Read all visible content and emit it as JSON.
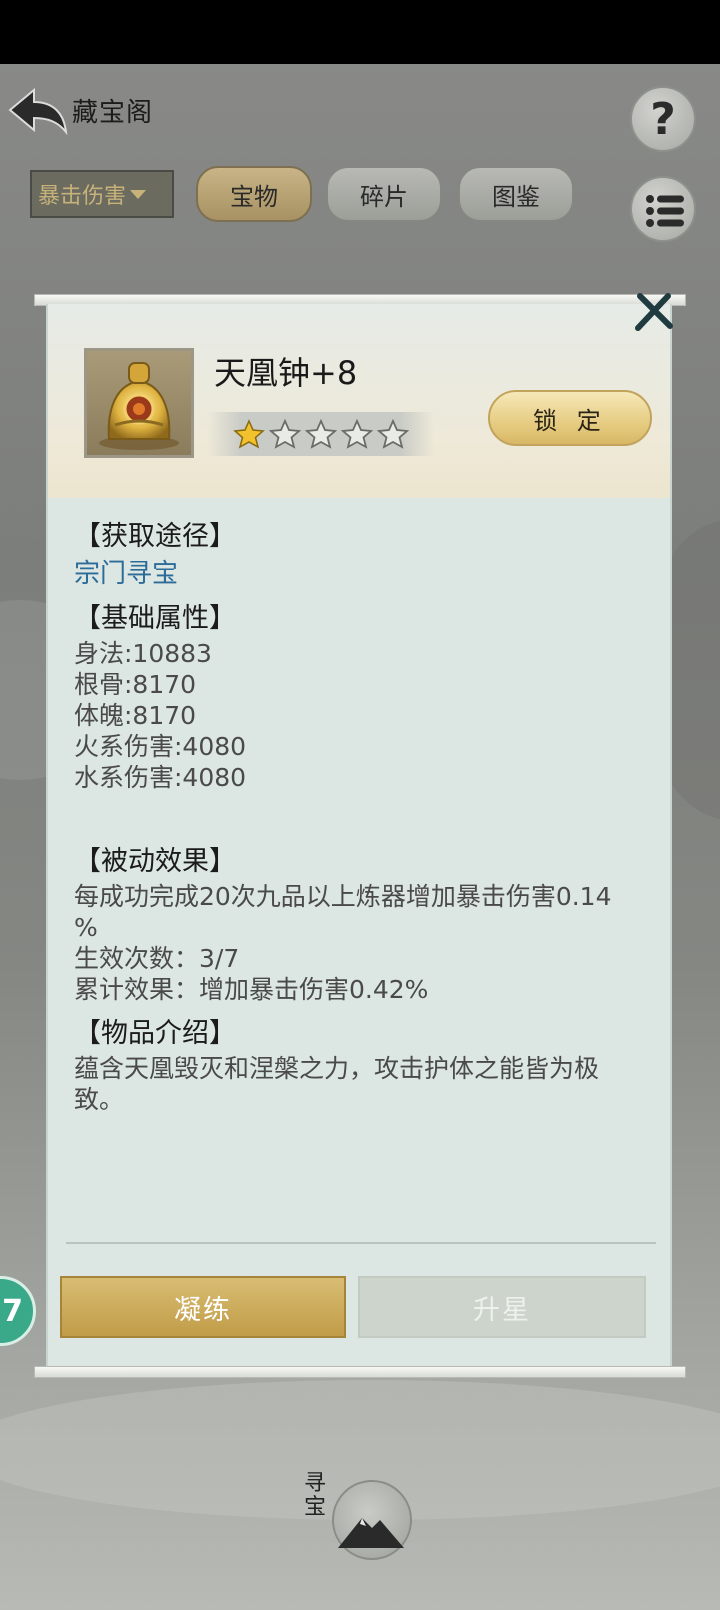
{
  "header": {
    "title": "藏宝阁",
    "help_label": "?"
  },
  "filter": {
    "selected": "暴击伤害"
  },
  "tabs": [
    {
      "label": "宝物",
      "active": true
    },
    {
      "label": "碎片",
      "active": false
    },
    {
      "label": "图鉴",
      "active": false
    }
  ],
  "side_badge": {
    "text": "7"
  },
  "item": {
    "name": "天凰钟+8",
    "stars_filled": 1,
    "stars_total": 5,
    "lock_label": "锁 定"
  },
  "sections": {
    "source": {
      "title": "【获取途径】",
      "link": "宗门寻宝"
    },
    "base_attrs": {
      "title": "【基础属性】",
      "lines": [
        "身法:10883",
        "根骨:8170",
        "体魄:8170",
        "火系伤害:4080",
        "水系伤害:4080"
      ]
    },
    "passive": {
      "title": "【被动效果】",
      "lines": [
        "每成功完成20次九品以上炼器增加暴击伤害0.14",
        "%",
        "生效次数：3/7",
        "累计效果：增加暴击伤害0.42%"
      ]
    },
    "intro": {
      "title": "【物品介绍】",
      "lines": [
        "蕴含天凰毁灭和涅槃之力，攻击护体之能皆为极",
        "致。"
      ]
    }
  },
  "actions": {
    "refine_label": "凝练",
    "upstar_label": "升星"
  },
  "bottom": {
    "emblem_text": "寻宝"
  },
  "colors": {
    "accent_gold": "#c09c48",
    "link_blue": "#2d6b98",
    "panel_bg": "#dce6e3"
  }
}
